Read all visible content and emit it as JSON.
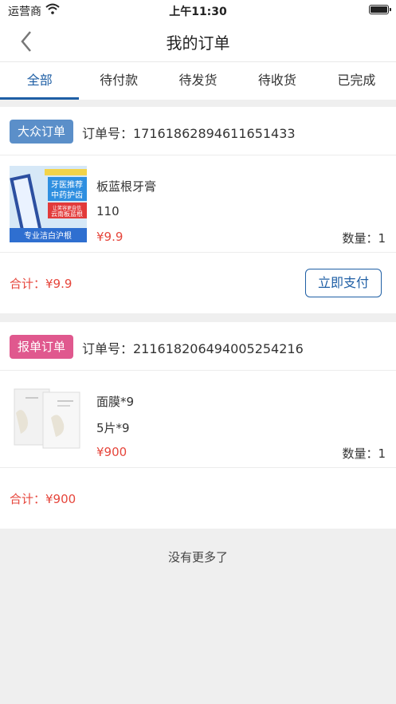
{
  "status_bar": {
    "carrier": "运营商",
    "time": "上午11:30"
  },
  "nav": {
    "title": "我的订单"
  },
  "tabs": [
    "全部",
    "待付款",
    "待发货",
    "待收货",
    "已完成"
  ],
  "orders": [
    {
      "badge": "大众订单",
      "badge_color": "#5b8fc9",
      "order_no": "订单号：17161862894611651433",
      "product": {
        "name": "板蓝根牙膏",
        "spec": "110",
        "price": "¥9.9",
        "qty": "数量：1",
        "image_text": {
          "line1": "牙医推荐",
          "line2": "中药护齿",
          "line3": "让笑容更自信",
          "line4": "云南板蓝根",
          "bottom": "专业洁白沪根"
        }
      },
      "total": "合计：¥9.9",
      "action": "立即支付"
    },
    {
      "badge": "报单订单",
      "badge_color": "#e0588e",
      "order_no": "订单号：211618206494005254216",
      "product": {
        "name": "面膜*9",
        "spec": "5片*9",
        "price": "¥900",
        "qty": "数量：1"
      },
      "total": "合计：¥900"
    }
  ],
  "footer": {
    "no_more": "没有更多了"
  }
}
